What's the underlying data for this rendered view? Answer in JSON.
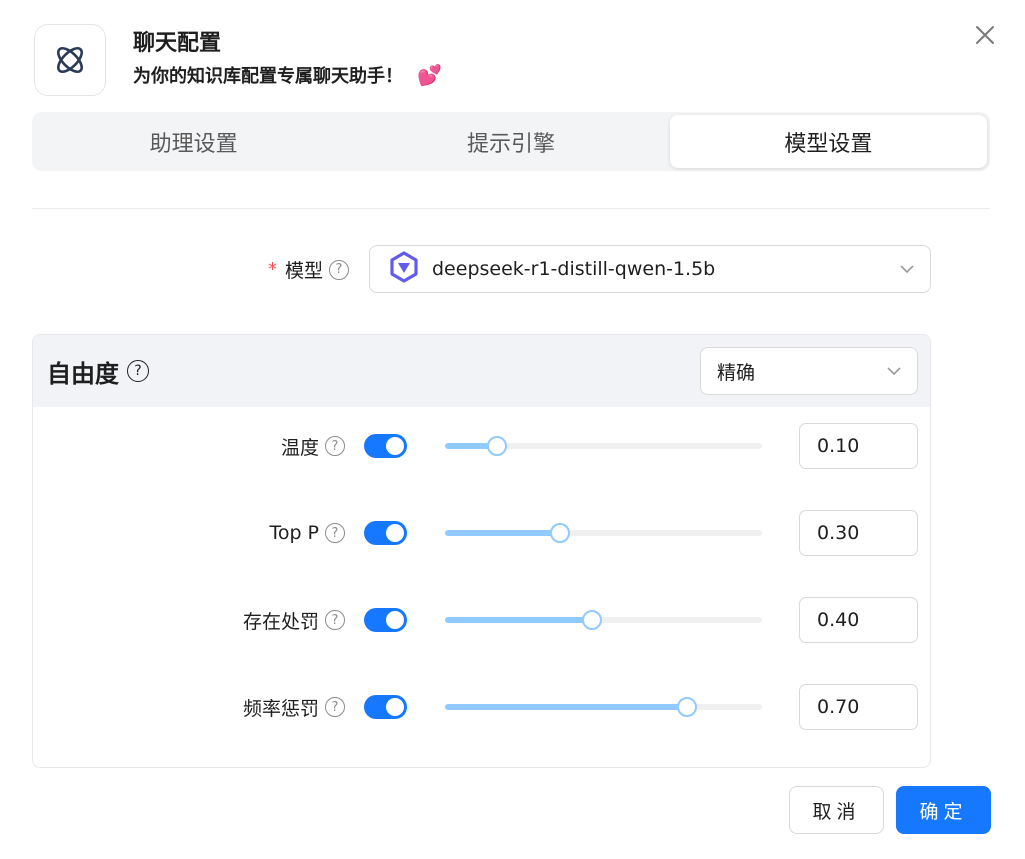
{
  "dialog": {
    "title": "聊天配置",
    "subtitle": "为你的知识库配置专属聊天助手！",
    "heart_icon": "💕"
  },
  "tabs": [
    {
      "label": "助理设置",
      "active": false
    },
    {
      "label": "提示引擎",
      "active": false
    },
    {
      "label": "模型设置",
      "active": true
    }
  ],
  "model": {
    "required_mark": "*",
    "label": "模型",
    "help": "?",
    "value": "deepseek-r1-distill-qwen-1.5b",
    "icon": "qwen-logo-icon"
  },
  "freedom": {
    "title": "自由度",
    "help": "?",
    "preset": "精确",
    "params": [
      {
        "label": "温度",
        "enabled": true,
        "value": 0.1,
        "display": "0.10"
      },
      {
        "label": "Top P",
        "enabled": true,
        "value": 0.3,
        "display": "0.30"
      },
      {
        "label": "存在处罚",
        "enabled": true,
        "value": 0.4,
        "display": "0.40"
      },
      {
        "label": "频率惩罚",
        "enabled": true,
        "value": 0.7,
        "display": "0.70"
      }
    ]
  },
  "footer": {
    "cancel": "取消",
    "confirm": "确定"
  },
  "colors": {
    "primary": "#1677ff",
    "slider_fill": "#91caff",
    "logo": "#615ced"
  }
}
